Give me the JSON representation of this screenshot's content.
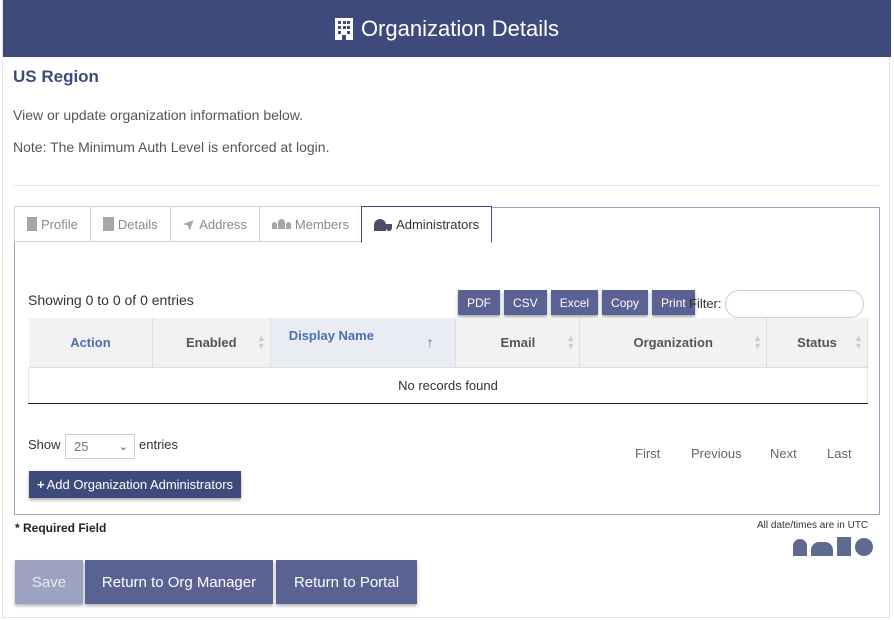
{
  "header": {
    "title": "Organization Details",
    "icon": "building-icon"
  },
  "region": "US Region",
  "intro": "View or update organization information below.",
  "note": "Note: The Minimum Auth Level is enforced at login.",
  "tabs": [
    {
      "label": "Profile",
      "icon": "building-icon"
    },
    {
      "label": "Details",
      "icon": "file-icon"
    },
    {
      "label": "Address",
      "icon": "location-arrow-icon"
    },
    {
      "label": "Members",
      "icon": "users-icon"
    },
    {
      "label": "Administrators",
      "icon": "user-shield-icon",
      "active": true
    }
  ],
  "table": {
    "showing": "Showing 0 to 0 of 0 entries",
    "export_buttons": [
      "PDF",
      "CSV",
      "Excel",
      "Copy",
      "Print"
    ],
    "filter_label": "Filter:",
    "filter_value": "",
    "columns": [
      "Action",
      "Enabled",
      "Display Name",
      "Email",
      "Organization",
      "Status"
    ],
    "sorted_column": "Display Name",
    "empty_message": "No records found",
    "show_label": "Show",
    "page_length": "25",
    "entries_label": "entries",
    "pager": {
      "first": "First",
      "previous": "Previous",
      "next": "Next",
      "last": "Last"
    }
  },
  "add_button": "Add Organization Administrators",
  "required_field": "* Required Field",
  "utc_note": "All date/times are in UTC",
  "legend_icons": [
    "user-icon",
    "users-icon",
    "building-icon",
    "globe-icon"
  ],
  "actions": {
    "save": "Save",
    "return_org": "Return to Org Manager",
    "return_portal": "Return to Portal"
  },
  "colors": {
    "brand": "#3f4a7c",
    "button": "#5a6294",
    "link": "#4a6fb5"
  }
}
